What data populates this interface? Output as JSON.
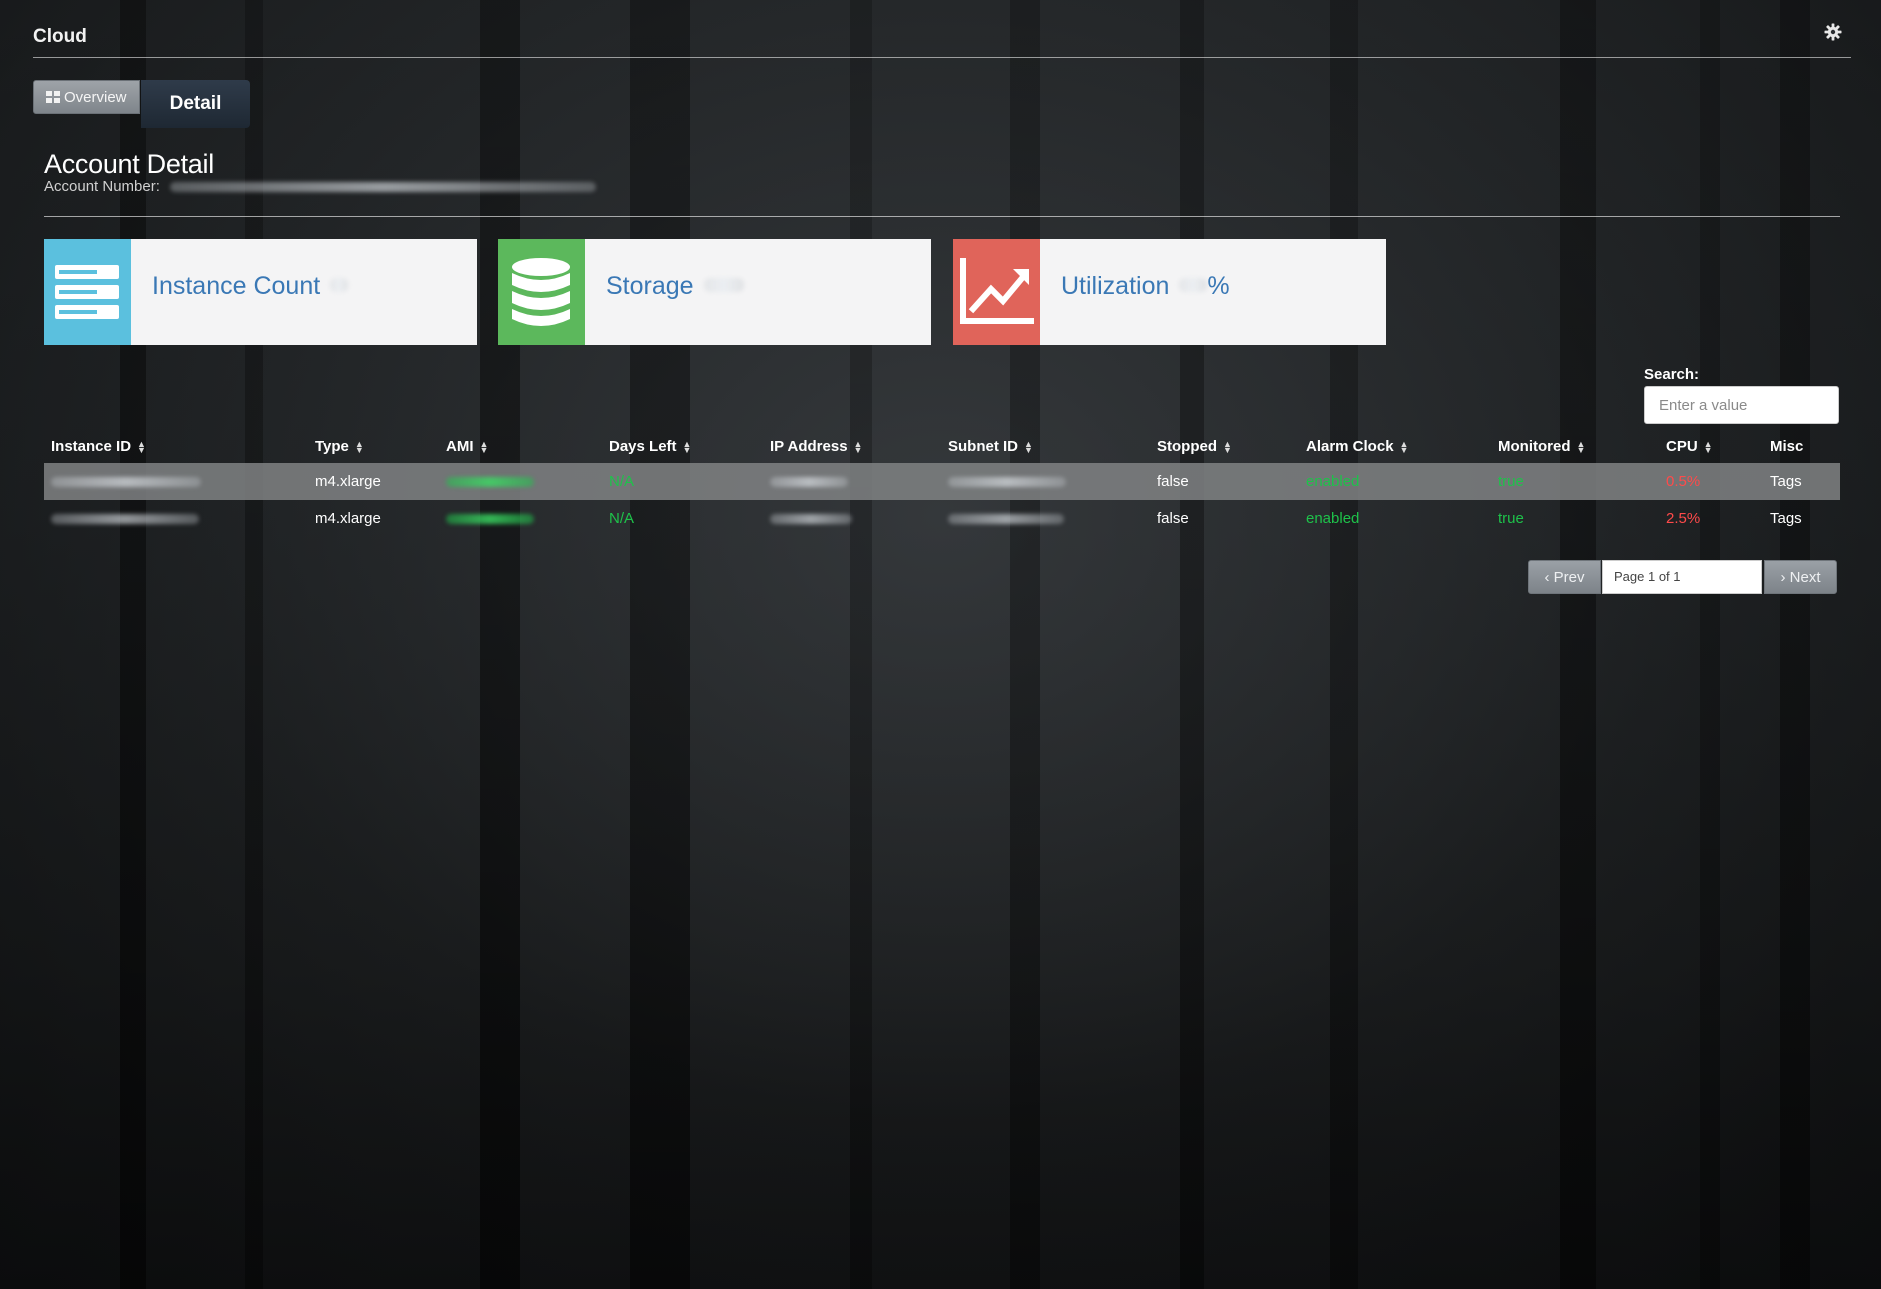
{
  "header": {
    "brand": "Cloud"
  },
  "tabs": {
    "overview": "Overview",
    "detail": "Detail"
  },
  "account": {
    "title": "Account Detail",
    "number_label": "Account Number:"
  },
  "cards": {
    "instance_count": {
      "label": "Instance Count",
      "color": "#5bc0de"
    },
    "storage": {
      "label": "Storage",
      "color": "#5cb85c"
    },
    "utilization": {
      "label": "Utilization",
      "suffix": "%",
      "color": "#e0645a"
    }
  },
  "search": {
    "label": "Search:",
    "placeholder": "Enter a value"
  },
  "table": {
    "columns": [
      "Instance ID",
      "Type",
      "AMI",
      "Days Left",
      "IP Address",
      "Subnet ID",
      "Stopped",
      "Alarm Clock",
      "Monitored",
      "CPU",
      "Misc"
    ],
    "rows": [
      {
        "type": "m4.xlarge",
        "days_left": "N/A",
        "stopped": "false",
        "alarm_clock": "enabled",
        "monitored": "true",
        "cpu": "0.5%",
        "misc": "Tags"
      },
      {
        "type": "m4.xlarge",
        "days_left": "N/A",
        "stopped": "false",
        "alarm_clock": "enabled",
        "monitored": "true",
        "cpu": "2.5%",
        "misc": "Tags"
      }
    ]
  },
  "pagination": {
    "prev": "Prev",
    "page_label": "Page 1 of 1",
    "next": "Next"
  }
}
